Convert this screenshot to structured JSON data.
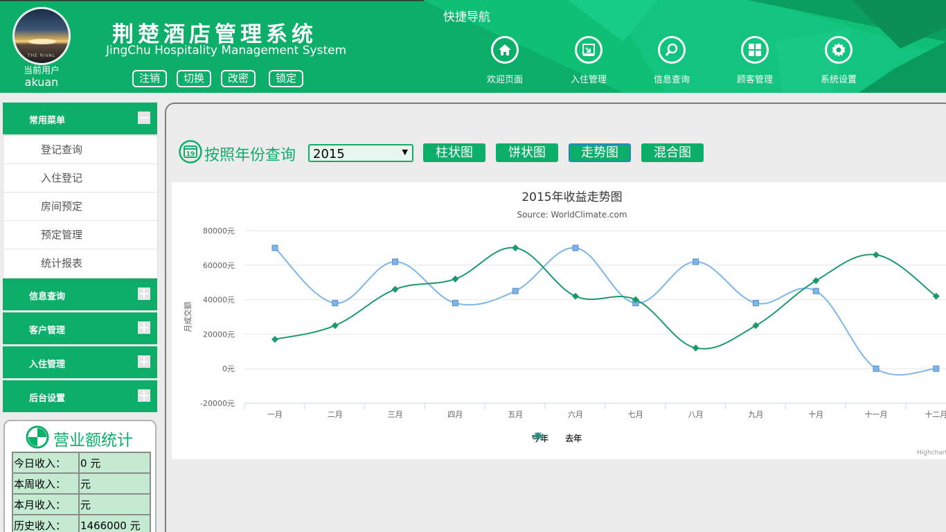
{
  "header": {
    "title": "荆楚酒店管理系统",
    "subtitle": "JingChu Hospitality Management System",
    "avatar_text": "THE RIVAL",
    "user_label": "当前用户",
    "user_name": "akuan",
    "buttons": [
      "注销",
      "切换",
      "改密",
      "锁定"
    ],
    "quick_nav_title": "快捷导航",
    "nav": [
      {
        "label": "欢迎页面",
        "icon": "home-icon"
      },
      {
        "label": "入住管理",
        "icon": "checkin-icon"
      },
      {
        "label": "信息查询",
        "icon": "search-icon"
      },
      {
        "label": "顾客管理",
        "icon": "grid-icon"
      },
      {
        "label": "系统设置",
        "icon": "gear-icon"
      }
    ],
    "colors": {
      "primary": "#0cae6a",
      "dark": "#0a9a5e",
      "light": "#2ccf87"
    }
  },
  "sidebar": {
    "common_menu": "常用菜单",
    "common_items": [
      "登记查询",
      "入住登记",
      "房间预定",
      "预定管理",
      "统计报表"
    ],
    "sections": [
      "信息查询",
      "客户管理",
      "入住管理",
      "后台设置"
    ]
  },
  "stats": {
    "title": "营业额统计",
    "rows": [
      {
        "label": "今日收入：",
        "value": "0 元"
      },
      {
        "label": "本周收入：",
        "value": "元"
      },
      {
        "label": "本月收入：",
        "value": "元"
      },
      {
        "label": "历史收入：",
        "value": "1466000 元"
      }
    ]
  },
  "query": {
    "label": "按照年份查询",
    "calendar_day": "19",
    "year": "2015",
    "buttons": [
      "柱状图",
      "饼状图",
      "走势图",
      "混合图"
    ],
    "active_index": 2
  },
  "chart_data": {
    "type": "line",
    "title": "2015年收益走势图",
    "subtitle": "Source: WorldClimate.com",
    "ylabel": "月成交额",
    "yunit": "元",
    "ylim": [
      -20000,
      80000
    ],
    "yticks": [
      80000,
      60000,
      40000,
      20000,
      0,
      -20000
    ],
    "categories": [
      "一月",
      "二月",
      "三月",
      "四月",
      "五月",
      "六月",
      "七月",
      "八月",
      "九月",
      "十月",
      "十一月",
      "十二月"
    ],
    "series": [
      {
        "name": "今年",
        "color": "#7cb5ec",
        "marker": "square",
        "values": [
          70000,
          38000,
          62000,
          38000,
          45000,
          70000,
          38000,
          62000,
          38000,
          45000,
          0,
          0
        ]
      },
      {
        "name": "去年",
        "color": "#1a9a6a",
        "marker": "diamond",
        "values": [
          17000,
          25000,
          46000,
          52000,
          70000,
          42000,
          40000,
          12000,
          25000,
          51000,
          66000,
          42000
        ]
      }
    ],
    "grid": true,
    "legend": "bottom-center",
    "credits": "Highcharts.com"
  }
}
